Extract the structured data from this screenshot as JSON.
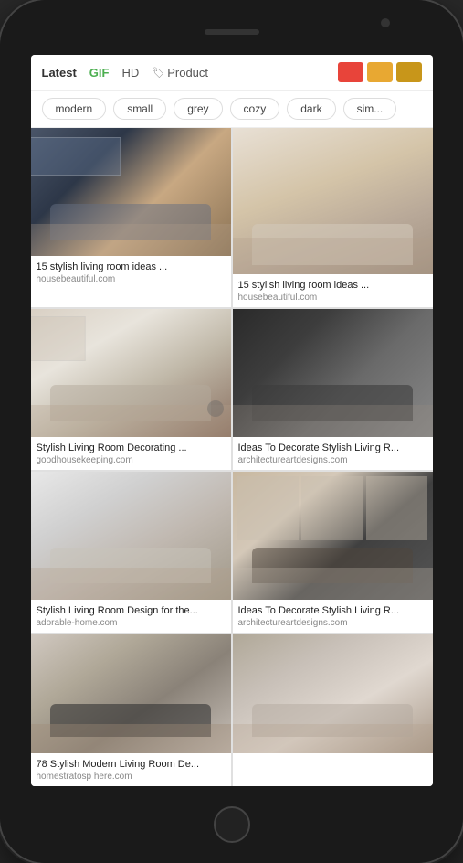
{
  "phone": {
    "filter_tabs": {
      "items": [
        {
          "id": "latest",
          "label": "Latest",
          "active": false,
          "special": null
        },
        {
          "id": "gif",
          "label": "GIF",
          "active": false,
          "special": "gif"
        },
        {
          "id": "hd",
          "label": "HD",
          "active": false,
          "special": null
        },
        {
          "id": "product",
          "label": "Product",
          "active": false,
          "special": "product"
        }
      ]
    },
    "color_swatches": [
      {
        "color": "#e8443a"
      },
      {
        "color": "#e8a832"
      },
      {
        "color": "#d4a832"
      }
    ],
    "category_chips": [
      {
        "label": "modern"
      },
      {
        "label": "small"
      },
      {
        "label": "grey"
      },
      {
        "label": "cozy"
      },
      {
        "label": "dark"
      },
      {
        "label": "sim..."
      }
    ],
    "grid_items": [
      {
        "id": "item1",
        "img_class": "img-lr1",
        "title": "15 stylish living room ideas ...",
        "source": "housebeautiful.com",
        "col": "left"
      },
      {
        "id": "item2",
        "img_class": "img-lr2",
        "title": "15 stylish living room ideas ...",
        "source": "housebeautiful.com",
        "col": "right"
      },
      {
        "id": "item3",
        "img_class": "img-lr3",
        "title": "Stylish Living Room Decorating ...",
        "source": "goodhousekeeping.com",
        "col": "left"
      },
      {
        "id": "item4",
        "img_class": "img-lr4",
        "title": "Ideas To Decorate Stylish Living R...",
        "source": "architectureartdesigns.com",
        "col": "right"
      },
      {
        "id": "item5",
        "img_class": "img-lr5",
        "title": "Stylish Living Room Design for the...",
        "source": "adorable-home.com",
        "col": "left"
      },
      {
        "id": "item6",
        "img_class": "img-lr6",
        "title": "Ideas To Decorate Stylish Living R...",
        "source": "architectureartdesigns.com",
        "col": "right"
      },
      {
        "id": "item7",
        "img_class": "img-lr7",
        "title": "78 Stylish Modern Living Room De...",
        "source": "homestratosp here.com",
        "col": "left"
      },
      {
        "id": "item8",
        "img_class": "img-lr8",
        "title": "",
        "source": "",
        "col": "right"
      }
    ]
  }
}
